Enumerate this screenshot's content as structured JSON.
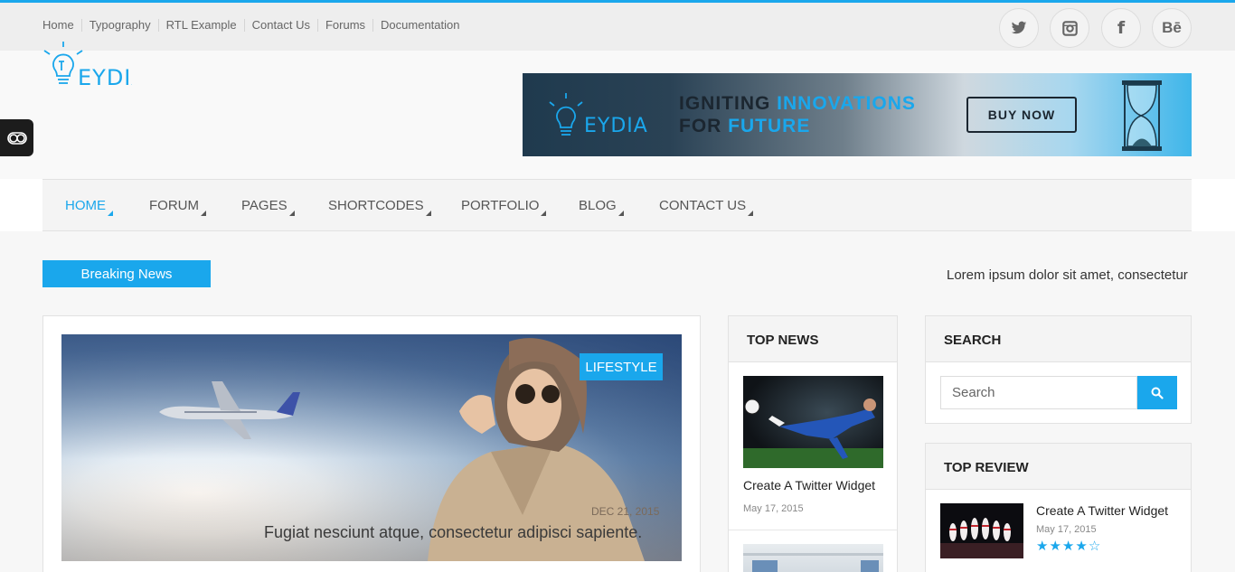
{
  "top_links": [
    "Home",
    "Typography",
    "RTL Example",
    "Contact Us",
    "Forums",
    "Documentation"
  ],
  "social": {
    "twitter": "twitter-icon",
    "instagram": "instagram-icon",
    "facebook": "f",
    "behance": "Bē"
  },
  "logo": {
    "text": "EYDIA"
  },
  "banner": {
    "logo_text": "EYDIA",
    "line1_a": "IGNITING ",
    "line1_b": "INNOVATIONS",
    "line2_a": "FOR ",
    "line2_b": "FUTURE",
    "button": "BUY NOW"
  },
  "nav": [
    "HOME",
    "FORUM",
    "PAGES",
    "SHORTCODES",
    "PORTFOLIO",
    "BLOG",
    "CONTACT US"
  ],
  "breaking": {
    "label": "Breaking News",
    "ticker": "Lorem ipsum dolor sit amet, consectetur adipisicing elit"
  },
  "featured": {
    "category": "LIFESTYLE",
    "date": "DEC 21, 2015",
    "title": "Fugiat nesciunt atque, consectetur adipisci sapiente."
  },
  "top_news": {
    "title": "TOP NEWS",
    "items": [
      {
        "title": "Create A Twitter Widget",
        "date": "May 17, 2015"
      }
    ]
  },
  "search_widget": {
    "title": "SEARCH",
    "placeholder": "Search"
  },
  "top_review": {
    "title": "TOP REVIEW",
    "items": [
      {
        "title": "Create A Twitter Widget",
        "date": "May 17, 2015",
        "rating": 4,
        "max_rating": 5
      }
    ]
  },
  "colors": {
    "accent": "#1aa7ec",
    "dark": "#1b2630"
  }
}
